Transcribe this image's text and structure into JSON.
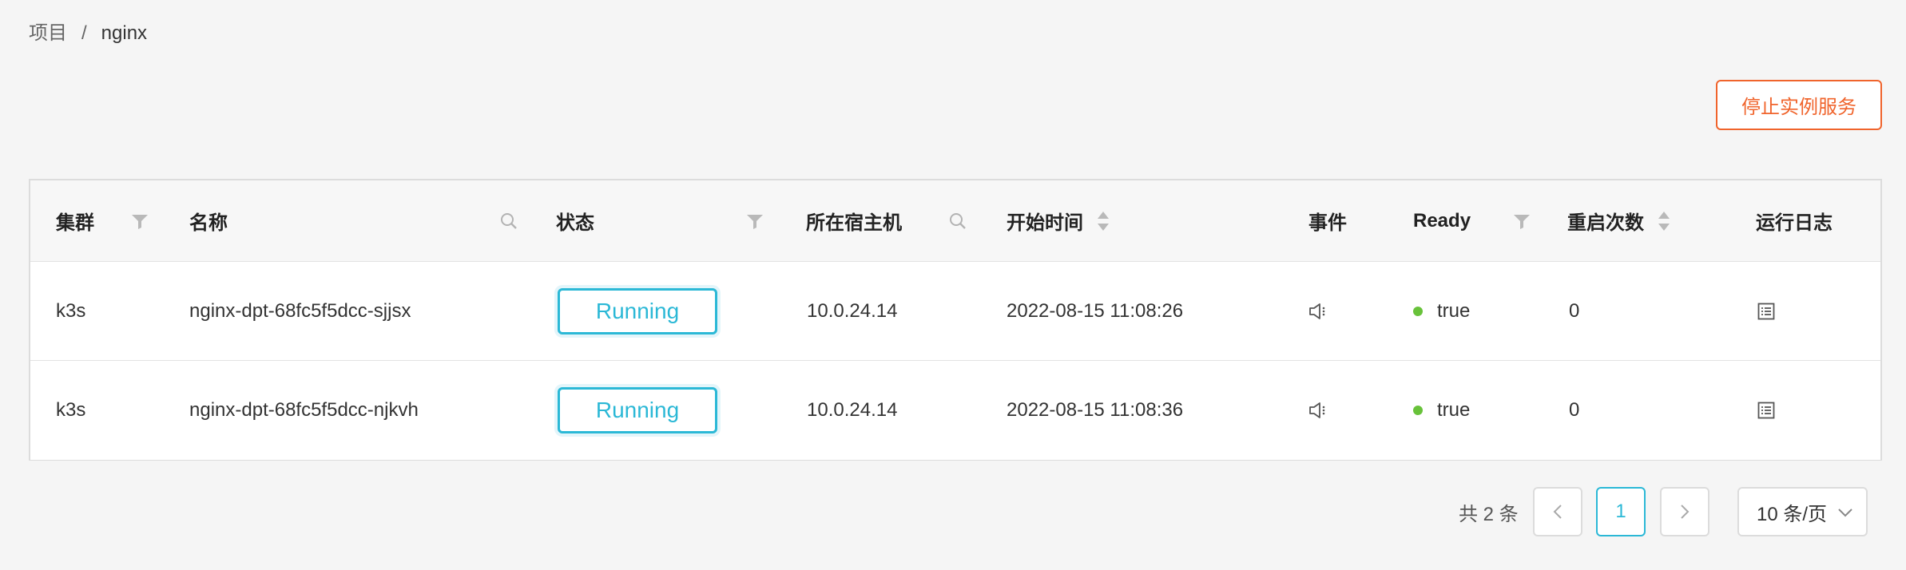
{
  "breadcrumb": {
    "root": "项目",
    "separator": "/",
    "current": "nginx"
  },
  "actions": {
    "stop_label": "停止实例服务"
  },
  "colors": {
    "accent": "#2bb8d6",
    "danger": "#f0642c",
    "ready_dot": "#68c23a"
  },
  "table": {
    "headers": {
      "cluster": "集群",
      "name": "名称",
      "status": "状态",
      "host": "所在宿主机",
      "start_time": "开始时间",
      "events": "事件",
      "ready": "Ready",
      "restarts": "重启次数",
      "logs": "运行日志"
    },
    "header_icons": {
      "cluster": "filter-icon",
      "name": "search-icon",
      "status": "filter-icon",
      "host": "search-icon",
      "start_time": "sort-icon",
      "ready": "filter-icon",
      "restarts": "sort-icon"
    },
    "rows": [
      {
        "cluster": "k3s",
        "name": "nginx-dpt-68fc5f5dcc-sjjsx",
        "status": "Running",
        "host": "10.0.24.14",
        "start_time": "2022-08-15 11:08:26",
        "events_icon": "speaker-icon",
        "ready": "true",
        "restarts": "0",
        "logs_icon": "log-list-icon"
      },
      {
        "cluster": "k3s",
        "name": "nginx-dpt-68fc5f5dcc-njkvh",
        "status": "Running",
        "host": "10.0.24.14",
        "start_time": "2022-08-15 11:08:36",
        "events_icon": "speaker-icon",
        "ready": "true",
        "restarts": "0",
        "logs_icon": "log-list-icon"
      }
    ]
  },
  "pagination": {
    "total_text": "共 2 条",
    "prev_icon": "chevron-left-icon",
    "current_page": "1",
    "next_icon": "chevron-right-icon",
    "page_size": "10 条/页"
  }
}
